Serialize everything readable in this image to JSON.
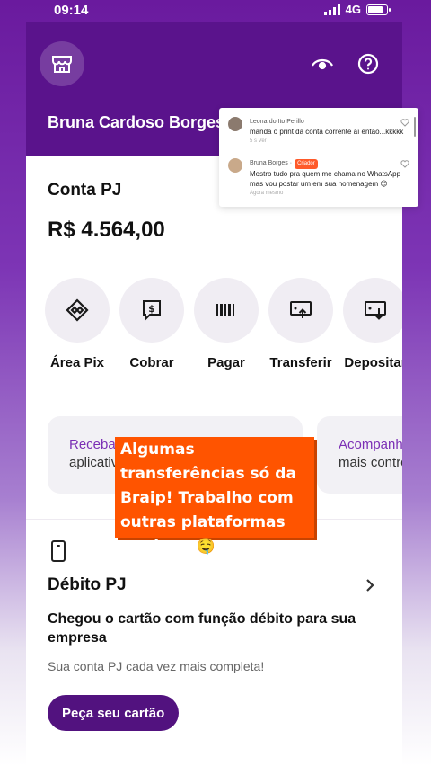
{
  "status_bar": {
    "time": "09:14",
    "network": "4G"
  },
  "header": {
    "user_name": "Bruna Cardoso Borges"
  },
  "account": {
    "title": "Conta PJ",
    "balance": "R$ 4.564,00"
  },
  "actions": [
    {
      "label": "Área Pix",
      "icon": "pix-icon"
    },
    {
      "label": "Cobrar",
      "icon": "charge-icon"
    },
    {
      "label": "Pagar",
      "icon": "barcode-icon"
    },
    {
      "label": "Transferir",
      "icon": "transfer-icon"
    },
    {
      "label": "Depositar",
      "icon": "deposit-icon"
    }
  ],
  "promos": [
    {
      "line1": "Receba",
      "line2": "aplicativ"
    },
    {
      "line1": "Acompanh",
      "line2": "mais contro"
    }
  ],
  "debit": {
    "title": "Débito PJ",
    "description": "Chegou o cartão com função débito para sua empresa",
    "subtitle": "Sua conta PJ cada vez mais completa!",
    "cta": "Peça seu cartão"
  },
  "comments": [
    {
      "author": "Leonardo Ito Perillo",
      "tag": "",
      "text": "manda o print da conta corrente aí então...kkkkk",
      "meta": "5 s  Ver"
    },
    {
      "author": "Bruna Borges ·",
      "tag": "Criador",
      "text": "Mostro tudo pra quem me chama no WhatsApp mas vou postar um em sua homenagem 😍",
      "meta": "Agora mesmo"
    }
  ],
  "caption": {
    "text": "Algumas transferências só da Braip! Trabalho com outras plataformas tambem 🤤"
  },
  "colors": {
    "brand_purple": "#5a138c",
    "cta": "#52127f",
    "caption_bg": "#ff5400"
  }
}
